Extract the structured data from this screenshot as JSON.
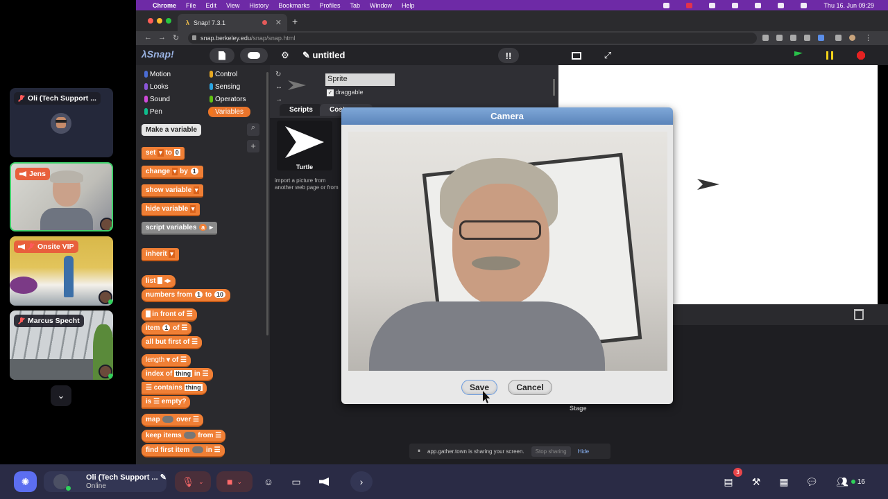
{
  "participants": [
    {
      "name": "Oli (Tech Support ...",
      "muted": true,
      "speaker": false
    },
    {
      "name": "Jens",
      "muted": false,
      "speaker": true
    },
    {
      "name": "Onsite VIP",
      "muted": true,
      "speaker": true
    },
    {
      "name": "Marcus Specht",
      "muted": true,
      "speaker": false
    }
  ],
  "menubar": {
    "app": "Chrome",
    "items": [
      "File",
      "Edit",
      "View",
      "History",
      "Bookmarks",
      "Profiles",
      "Tab",
      "Window",
      "Help"
    ],
    "clock": "Thu 16. Jun 09:29"
  },
  "browser": {
    "tab_title": "Snap! 7.3.1",
    "url_host": "snap.berkeley.edu",
    "url_path": "/snap/snap.html"
  },
  "snap": {
    "project_title": "untitled",
    "categories": [
      "Motion",
      "Looks",
      "Sound",
      "Pen",
      "Control",
      "Sensing",
      "Operators",
      "Variables"
    ],
    "category_colors": [
      "#4a6cd4",
      "#8a55d7",
      "#cf4ad9",
      "#0fbd8c",
      "#e6a822",
      "#2ca5e2",
      "#62c213",
      "#f3761d"
    ],
    "make_variable": "Make a variable",
    "blocks": {
      "set": "set",
      "to": "to",
      "zero": "0",
      "change": "change",
      "by": "by",
      "one": "1",
      "show_variable": "show variable",
      "hide_variable": "hide variable",
      "script_variables": "script variables",
      "a": "a",
      "inherit": "inherit",
      "list": "list",
      "numbers_from": "numbers from",
      "ten": "10",
      "in_front_of": "in front of",
      "item": "item",
      "of": "of",
      "all_but_first_of": "all but first of",
      "length": "length",
      "index_of": "index of",
      "thing": "thing",
      "in": "in",
      "contains": "contains",
      "is": "is",
      "empty": "empty?",
      "map": "map",
      "over": "over",
      "keep_items": "keep items",
      "from": "from",
      "find_first_item": "find first item"
    },
    "sprite_name": "Sprite",
    "draggable": "draggable",
    "tab_scripts": "Scripts",
    "tab_costumes": "Costumes",
    "costume_name": "Turtle",
    "import_hint": "import a picture from another web page or from a file on your computer by dropping it here",
    "stage_label": "Stage"
  },
  "dialog": {
    "title": "Camera",
    "save": "Save",
    "cancel": "Cancel"
  },
  "share_bar": {
    "message": "app.gather.town is sharing your screen.",
    "stop": "Stop sharing",
    "hide": "Hide"
  },
  "gather": {
    "me_name": "Oli (Tech Support ...",
    "me_status": "Online",
    "notifications": "3",
    "participants_count": "16"
  }
}
